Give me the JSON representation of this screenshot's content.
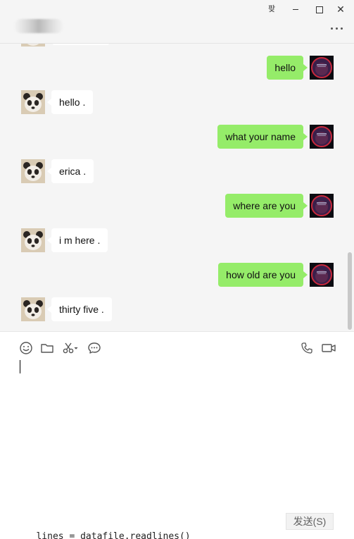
{
  "window": {
    "pin_glyph": "팢",
    "close_glyph": "✕"
  },
  "header": {
    "contact_name_blurred": true
  },
  "icons": {
    "emoji": "emoji-icon",
    "file": "folder-icon",
    "screenshot": "scissors-icon",
    "chat_history": "chat-bubble-icon",
    "voice_call": "phone-icon",
    "video_call": "video-camera-icon"
  },
  "messages": [
    {
      "sender": "self",
      "text": "hello"
    },
    {
      "sender": "other",
      "text": "hello ."
    },
    {
      "sender": "self",
      "text": "what your name"
    },
    {
      "sender": "other",
      "text": "erica ."
    },
    {
      "sender": "self",
      "text": "where are you"
    },
    {
      "sender": "other",
      "text": "i m here ."
    },
    {
      "sender": "self",
      "text": "how old are you"
    },
    {
      "sender": "other",
      "text": "thirty five ."
    }
  ],
  "composer": {
    "send_label": "发送(S)",
    "input_value": ""
  },
  "background_window": {
    "code_fragment": "   lines = datafile.readlines()"
  },
  "colors": {
    "self_bubble": "#95ec69",
    "other_bubble": "#ffffff",
    "chat_background": "#f5f5f5"
  }
}
